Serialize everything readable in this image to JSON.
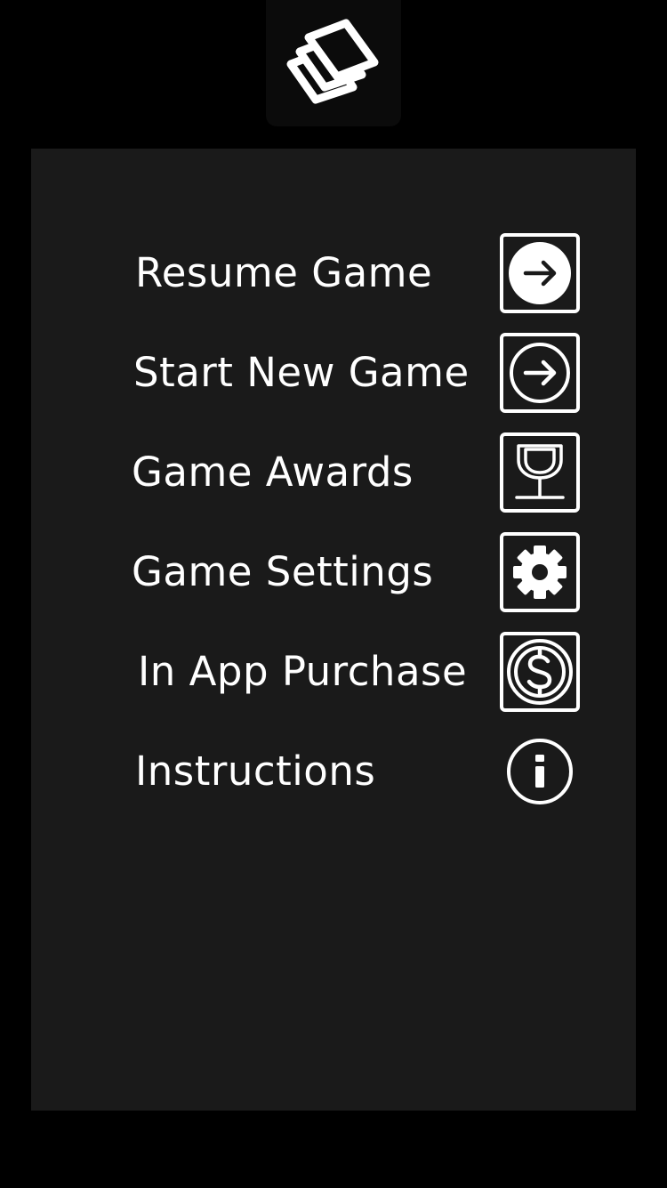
{
  "app": {
    "logo_icon": "stacked-cards-icon"
  },
  "menu": {
    "items": [
      {
        "id": "resume",
        "label": "Resume Game",
        "icon": "arrow-right-filled-circle-icon"
      },
      {
        "id": "new",
        "label": "Start New Game",
        "icon": "arrow-right-outline-circle-icon"
      },
      {
        "id": "awards",
        "label": "Game Awards",
        "icon": "trophy-icon"
      },
      {
        "id": "settings",
        "label": "Game Settings",
        "icon": "gear-icon"
      },
      {
        "id": "purchase",
        "label": "In App Purchase",
        "icon": "dollar-coin-icon"
      },
      {
        "id": "instructions",
        "label": "Instructions",
        "icon": "info-icon"
      }
    ]
  },
  "colors": {
    "background": "#000000",
    "panel": "#1a1a1a",
    "foreground": "#ffffff"
  }
}
